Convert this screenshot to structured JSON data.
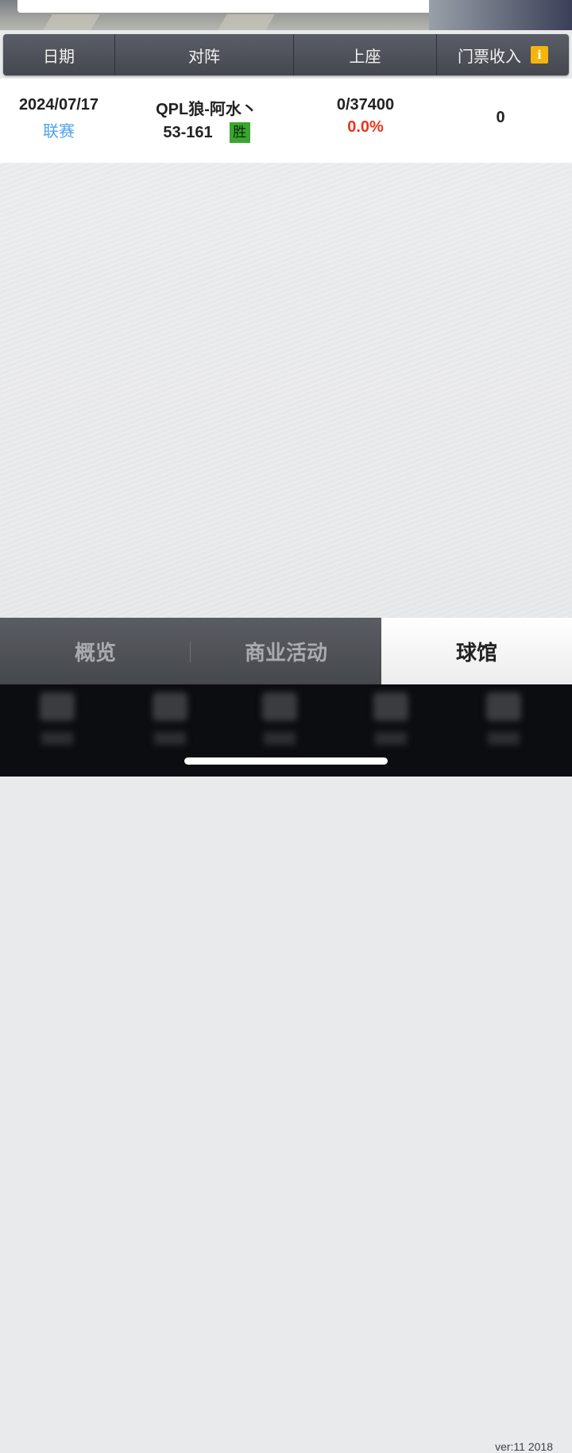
{
  "table": {
    "headers": {
      "date": "日期",
      "match": "对阵",
      "attendance": "上座",
      "ticket_income": "门票收入",
      "info_icon_glyph": "i"
    },
    "rows": [
      {
        "date": "2024/07/17",
        "type": "联赛",
        "opponent": "QPL狼-阿水丶",
        "score": "53-161",
        "result": "胜",
        "attendance": "0/37400",
        "attendance_rate": "0.0%",
        "income": "0"
      }
    ]
  },
  "bottom_tabs": [
    {
      "label": "概览",
      "active": false
    },
    {
      "label": "商业活动",
      "active": false
    },
    {
      "label": "球馆",
      "active": true
    }
  ],
  "footer": {
    "version": "ver:11  2018"
  },
  "colors": {
    "header_bg": "#4d5057",
    "type_link": "#4fa3e6",
    "rate_red": "#e8361e",
    "win_green": "#3aa52f",
    "info_yellow": "#f5b40b"
  },
  "icons": [
    "info-icon"
  ]
}
